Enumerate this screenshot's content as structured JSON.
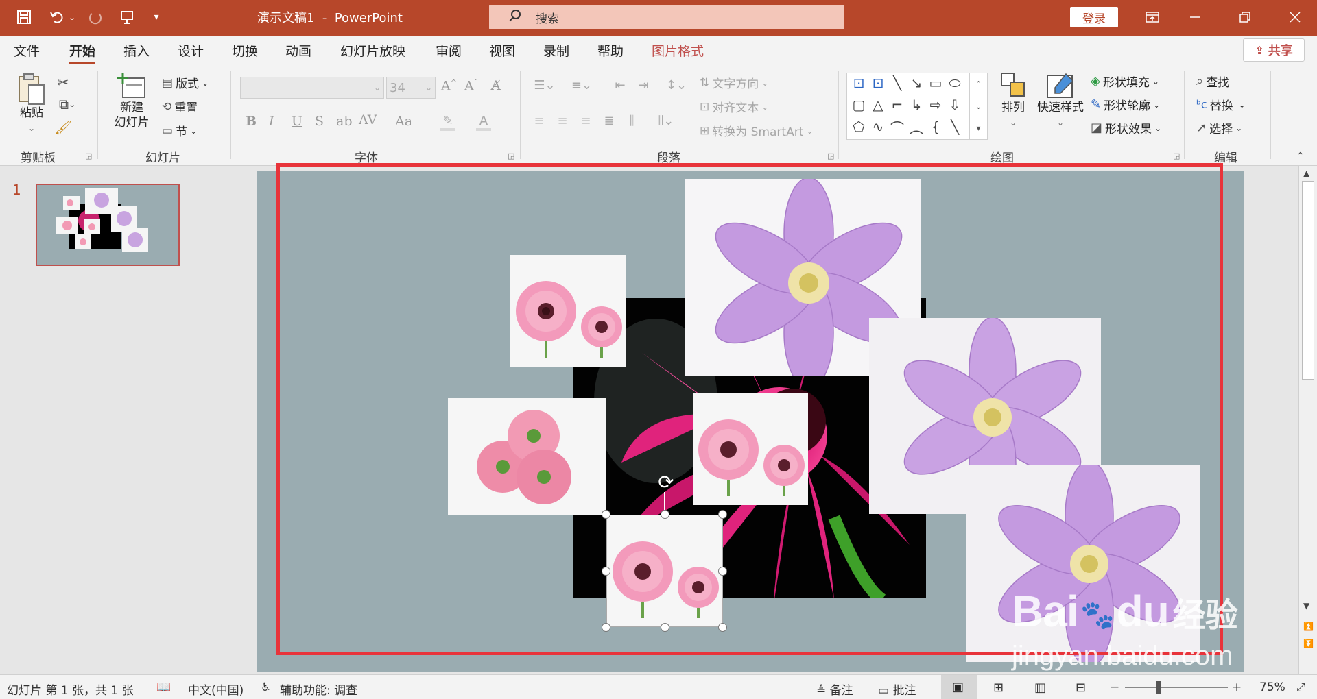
{
  "titlebar": {
    "doc_title": "演示文稿1  -  PowerPoint",
    "search_placeholder": "搜索",
    "login_label": "登录",
    "icons": [
      "save-icon",
      "undo-icon",
      "redo-icon",
      "present-icon",
      "customize-icon",
      "ribbon-display-icon",
      "minimize-icon",
      "restore-icon",
      "close-icon"
    ]
  },
  "tabs": [
    {
      "label": "文件"
    },
    {
      "label": "开始",
      "active": true
    },
    {
      "label": "插入"
    },
    {
      "label": "设计"
    },
    {
      "label": "切换"
    },
    {
      "label": "动画"
    },
    {
      "label": "幻灯片放映"
    },
    {
      "label": "审阅"
    },
    {
      "label": "视图"
    },
    {
      "label": "录制"
    },
    {
      "label": "帮助"
    },
    {
      "label": "图片格式",
      "contextual": true
    }
  ],
  "share_label": "共享",
  "ribbon": {
    "clipboard": {
      "paste": "粘贴",
      "group": "剪贴板"
    },
    "slides": {
      "new_slide_1": "新建",
      "new_slide_2": "幻灯片",
      "layout": "版式",
      "reset": "重置",
      "section": "节",
      "group": "幻灯片"
    },
    "font": {
      "size": "34",
      "bold": "B",
      "italic": "I",
      "underline": "U",
      "shadow": "S",
      "strike": "ab",
      "spacing": "AV",
      "case": "Aa",
      "group": "字体"
    },
    "paragraph": {
      "text_direction": "文字方向",
      "align_text": "对齐文本",
      "smartart": "转换为 SmartArt",
      "group": "段落"
    },
    "drawing": {
      "arrange": "排列",
      "quick_styles": "快速样式",
      "fill": "形状填充",
      "outline": "形状轮廓",
      "effects": "形状效果",
      "group": "绘图"
    },
    "editing": {
      "find": "查找",
      "replace": "替换",
      "select": "选择",
      "group": "编辑"
    }
  },
  "slide_pane": {
    "slide_number": "1"
  },
  "statusbar": {
    "slide_info": "幻灯片 第 1 张，共 1 张",
    "language": "中文(中国)",
    "accessibility": "辅助功能: 调查",
    "notes": "备注",
    "comments": "批注",
    "zoom_minus": "−",
    "zoom_plus": "+",
    "zoom": "75%"
  },
  "watermark": {
    "brand": "Bai",
    "brand2": "du",
    "cn": "经验",
    "url": "jingyan.baidu.com"
  },
  "colors": {
    "accent": "#b7472a",
    "slide_bg": "#9aacb1",
    "highlight_frame": "#e8333a"
  }
}
